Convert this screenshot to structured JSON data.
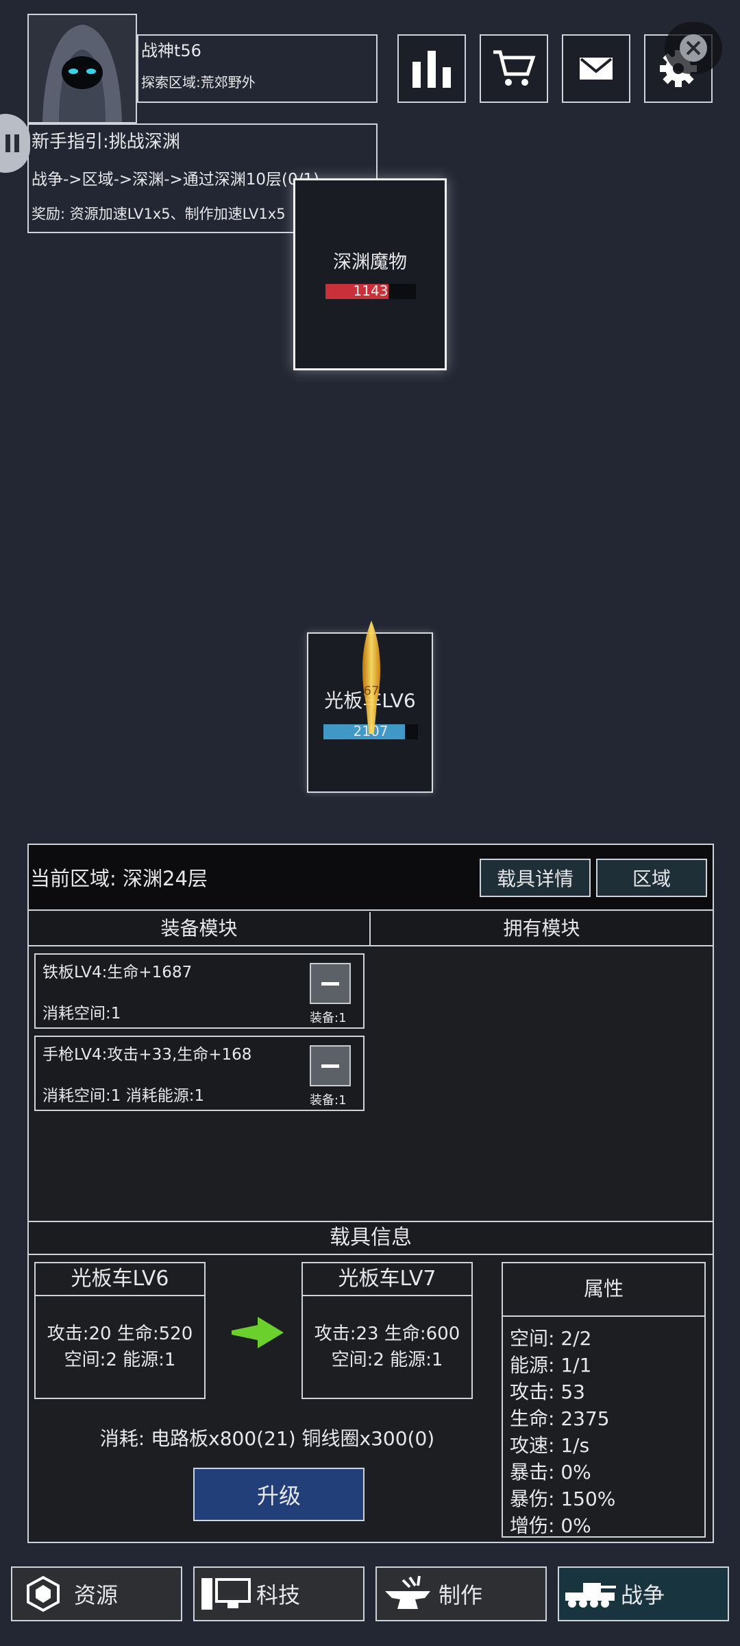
{
  "player": {
    "name": "战神t56",
    "region_label": "探索区域:荒郊野外"
  },
  "guide": {
    "title": "新手指引:挑战深渊",
    "path": "战争->区域->深渊->通过深渊10层(0/1)",
    "reward": "奖励: 资源加速LV1x5、制作加速LV1x5"
  },
  "top_buttons": [
    "stats-icon",
    "cart-icon",
    "mail-icon",
    "gear-icon"
  ],
  "enemy": {
    "name": "深渊魔物",
    "hp": "1143",
    "hp_fraction": 0.7
  },
  "vehicle_card": {
    "name": "光板车LV6",
    "hp": "2107",
    "hp_fraction": 0.86,
    "overlay_number": "67"
  },
  "panel": {
    "region": "当前区域: 深渊24层",
    "vehicle_detail_button": "载具详情",
    "region_button": "区域",
    "tab_equipped": "装备模块",
    "tab_owned": "拥有模块",
    "modules": [
      {
        "line1": "铁板LV4:生命+1687",
        "line2": "消耗空间:1",
        "equip": "装备:1"
      },
      {
        "line1": "手枪LV4:攻击+33,生命+168",
        "line2": "消耗空间:1  消耗能源:1",
        "equip": "装备:1"
      }
    ],
    "info_header": "载具信息",
    "current": {
      "title": "光板车LV6",
      "line1": "攻击:20 生命:520",
      "line2": "空间:2 能源:1"
    },
    "next": {
      "title": "光板车LV7",
      "line1": "攻击:23 生命:600",
      "line2": "空间:2 能源:1"
    },
    "cost": "消耗: 电路板x800(21) 铜线圈x300(0)",
    "upgrade_button": "升级",
    "attributes_title": "属性",
    "attributes": [
      "空间: 2/2",
      "能源: 1/1",
      "攻击: 53",
      "生命: 2375",
      "攻速: 1/s",
      "暴击: 0%",
      "暴伤: 150%",
      "增伤: 0%"
    ]
  },
  "nav": [
    {
      "label": "资源",
      "icon": "resource-icon"
    },
    {
      "label": "科技",
      "icon": "computer-icon"
    },
    {
      "label": "制作",
      "icon": "anvil-icon"
    },
    {
      "label": "战争",
      "icon": "tank-icon"
    }
  ],
  "colors": {
    "background": "#232733",
    "enemy_hp": "#c9303a",
    "vehicle_hp": "#3f98c6",
    "upgrade": "#223f7a",
    "active_nav": "#17343f"
  }
}
